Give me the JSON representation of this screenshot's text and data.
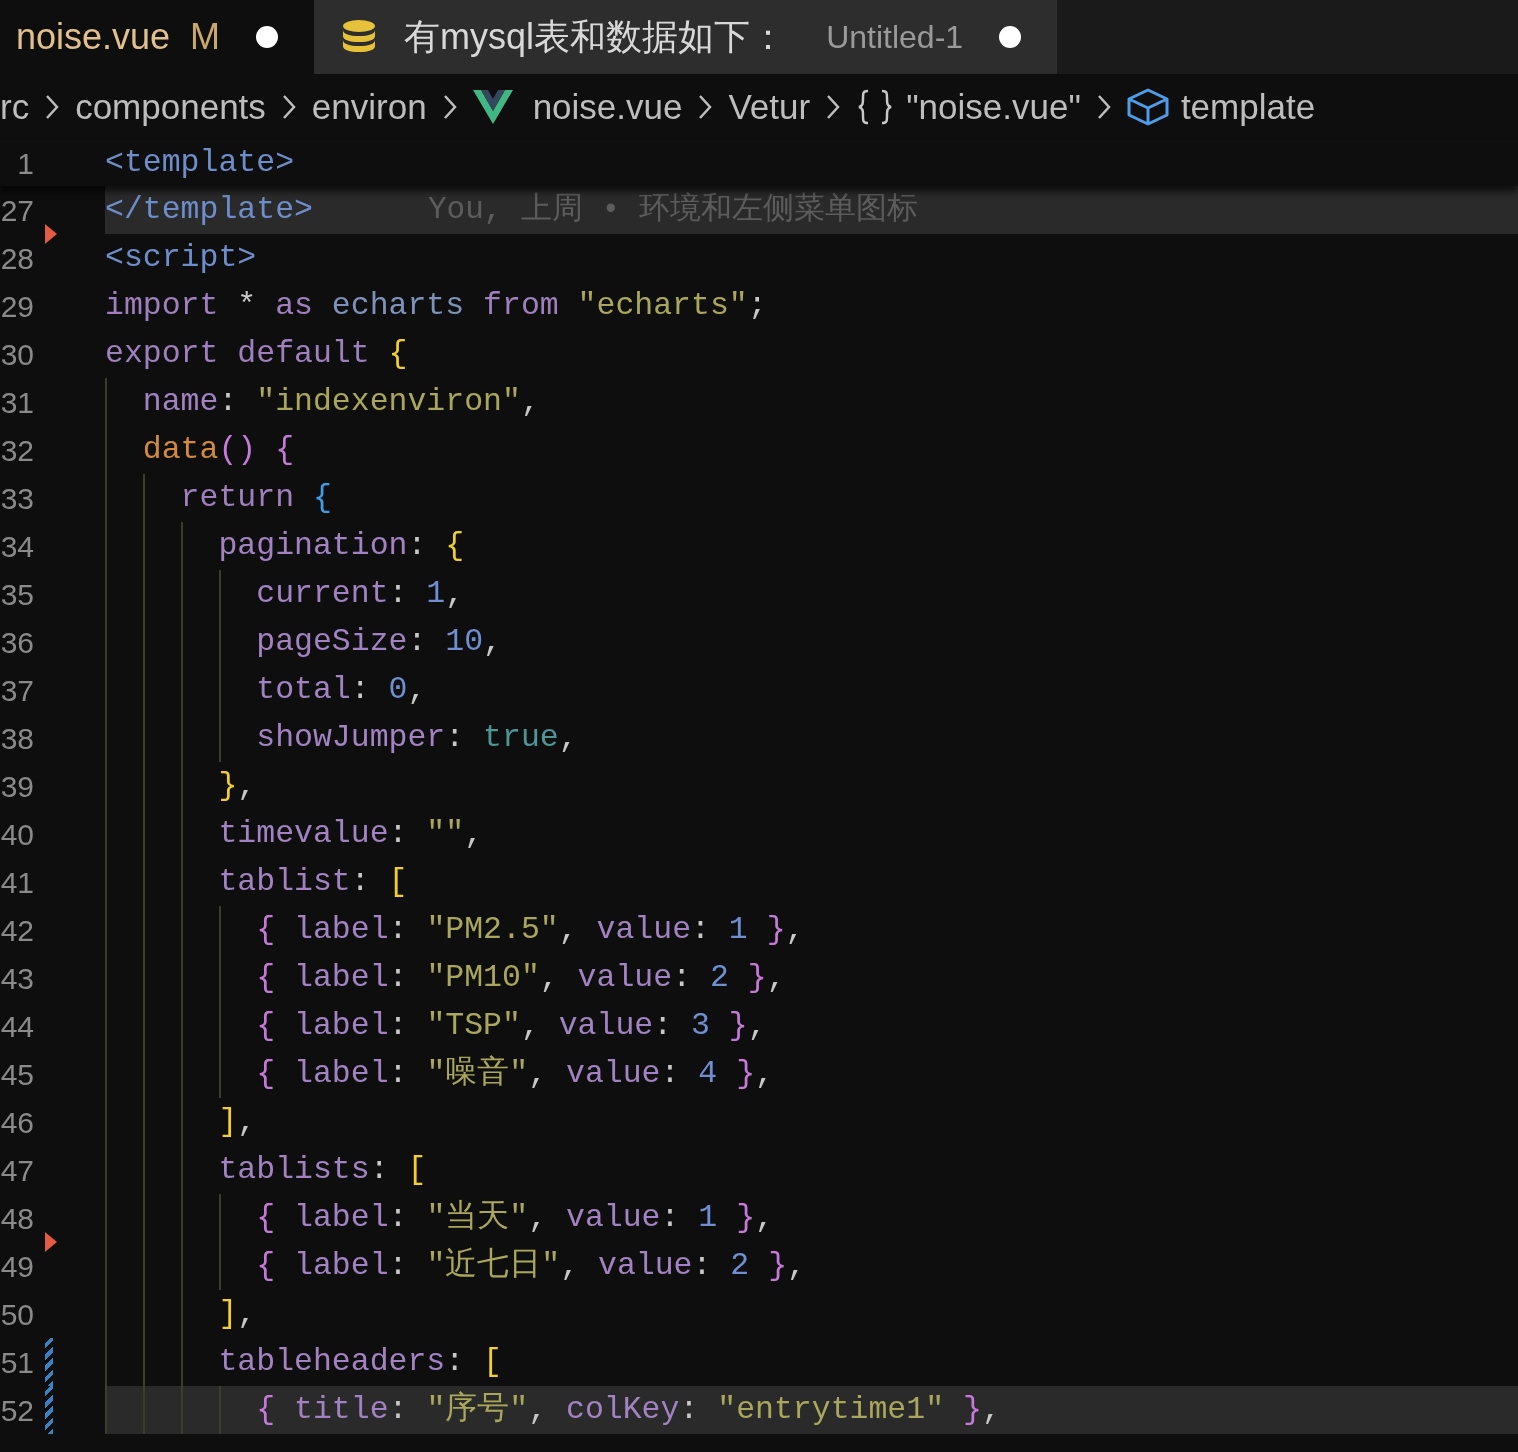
{
  "tabs": [
    {
      "kind": "file",
      "label": "noise.vue",
      "badge": "M",
      "dirty": true,
      "selected": true
    },
    {
      "kind": "query",
      "label": "有mysql表和数据如下：",
      "description": "Untitled-1",
      "dirty": true,
      "selected": false
    }
  ],
  "breadcrumb": [
    {
      "kind": "folder",
      "label": "rc"
    },
    {
      "kind": "folder",
      "label": "components"
    },
    {
      "kind": "folder",
      "label": "environ"
    },
    {
      "kind": "file",
      "label": "noise.vue"
    },
    {
      "kind": "language",
      "label": "Vetur"
    },
    {
      "kind": "module",
      "label": "\"noise.vue\""
    },
    {
      "kind": "element",
      "label": "template"
    }
  ],
  "sticky_line": {
    "number": "1",
    "tokens": [
      {
        "kind": "tag",
        "text": "<template>"
      }
    ]
  },
  "lines": [
    {
      "number": "27",
      "highlighted": true,
      "deleted_above": false,
      "modified": false,
      "blame": "You, 上周 • 环境和左侧菜单图标",
      "tokens": [
        {
          "kind": "tag",
          "text": "</template>"
        }
      ]
    },
    {
      "number": "28",
      "highlighted": false,
      "deleted_above": true,
      "modified": false,
      "tokens": [
        {
          "kind": "tag",
          "text": "<script>"
        }
      ]
    },
    {
      "number": "29",
      "highlighted": false,
      "deleted_above": false,
      "modified": false,
      "tokens": [
        {
          "kind": "keyword",
          "text": "import"
        },
        {
          "kind": "plain",
          "text": " * "
        },
        {
          "kind": "keyword",
          "text": "as"
        },
        {
          "kind": "ident",
          "text": " echarts"
        },
        {
          "kind": "keyword",
          "text": " from"
        },
        {
          "kind": "string",
          "text": " \"echarts\""
        },
        {
          "kind": "plain",
          "text": ";"
        }
      ]
    },
    {
      "number": "30",
      "highlighted": false,
      "deleted_above": false,
      "modified": false,
      "tokens": [
        {
          "kind": "keyword",
          "text": "export default"
        },
        {
          "kind": "brace1",
          "text": " {"
        }
      ]
    },
    {
      "number": "31",
      "highlighted": false,
      "deleted_above": false,
      "modified": false,
      "tokens": [
        {
          "kind": "prop",
          "text": "  name"
        },
        {
          "kind": "plain",
          "text": ": "
        },
        {
          "kind": "string",
          "text": "\"indexenviron\""
        },
        {
          "kind": "plain",
          "text": ","
        }
      ]
    },
    {
      "number": "32",
      "highlighted": false,
      "deleted_above": false,
      "modified": false,
      "tokens": [
        {
          "kind": "func",
          "text": "  data"
        },
        {
          "kind": "brace2",
          "text": "()"
        },
        {
          "kind": "brace2",
          "text": " {"
        }
      ]
    },
    {
      "number": "33",
      "highlighted": false,
      "deleted_above": false,
      "modified": false,
      "tokens": [
        {
          "kind": "keyword",
          "text": "    return"
        },
        {
          "kind": "brace3",
          "text": " {"
        }
      ]
    },
    {
      "number": "34",
      "highlighted": false,
      "deleted_above": false,
      "modified": false,
      "tokens": [
        {
          "kind": "prop",
          "text": "      pagination"
        },
        {
          "kind": "plain",
          "text": ": "
        },
        {
          "kind": "brace1",
          "text": "{"
        }
      ]
    },
    {
      "number": "35",
      "highlighted": false,
      "deleted_above": false,
      "modified": false,
      "tokens": [
        {
          "kind": "prop",
          "text": "        current"
        },
        {
          "kind": "plain",
          "text": ": "
        },
        {
          "kind": "number",
          "text": "1"
        },
        {
          "kind": "plain",
          "text": ","
        }
      ]
    },
    {
      "number": "36",
      "highlighted": false,
      "deleted_above": false,
      "modified": false,
      "tokens": [
        {
          "kind": "prop",
          "text": "        pageSize"
        },
        {
          "kind": "plain",
          "text": ": "
        },
        {
          "kind": "number",
          "text": "10"
        },
        {
          "kind": "plain",
          "text": ","
        }
      ]
    },
    {
      "number": "37",
      "highlighted": false,
      "deleted_above": false,
      "modified": false,
      "tokens": [
        {
          "kind": "prop",
          "text": "        total"
        },
        {
          "kind": "plain",
          "text": ": "
        },
        {
          "kind": "number",
          "text": "0"
        },
        {
          "kind": "plain",
          "text": ","
        }
      ]
    },
    {
      "number": "38",
      "highlighted": false,
      "deleted_above": false,
      "modified": false,
      "tokens": [
        {
          "kind": "prop",
          "text": "        showJumper"
        },
        {
          "kind": "plain",
          "text": ": "
        },
        {
          "kind": "bool",
          "text": "true"
        },
        {
          "kind": "plain",
          "text": ","
        }
      ]
    },
    {
      "number": "39",
      "highlighted": false,
      "deleted_above": false,
      "modified": false,
      "tokens": [
        {
          "kind": "brace1",
          "text": "      }"
        },
        {
          "kind": "plain",
          "text": ","
        }
      ]
    },
    {
      "number": "40",
      "highlighted": false,
      "deleted_above": false,
      "modified": false,
      "tokens": [
        {
          "kind": "prop",
          "text": "      timevalue"
        },
        {
          "kind": "plain",
          "text": ": "
        },
        {
          "kind": "string",
          "text": "\"\""
        },
        {
          "kind": "plain",
          "text": ","
        }
      ]
    },
    {
      "number": "41",
      "highlighted": false,
      "deleted_above": false,
      "modified": false,
      "tokens": [
        {
          "kind": "prop",
          "text": "      tablist"
        },
        {
          "kind": "plain",
          "text": ": "
        },
        {
          "kind": "brace1",
          "text": "["
        }
      ]
    },
    {
      "number": "42",
      "highlighted": false,
      "deleted_above": false,
      "modified": false,
      "tokens": [
        {
          "kind": "brace2",
          "text": "        {"
        },
        {
          "kind": "prop",
          "text": " label"
        },
        {
          "kind": "plain",
          "text": ": "
        },
        {
          "kind": "string",
          "text": "\"PM2.5\""
        },
        {
          "kind": "plain",
          "text": ", "
        },
        {
          "kind": "prop",
          "text": "value"
        },
        {
          "kind": "plain",
          "text": ": "
        },
        {
          "kind": "number",
          "text": "1"
        },
        {
          "kind": "brace2",
          "text": " }"
        },
        {
          "kind": "plain",
          "text": ","
        }
      ]
    },
    {
      "number": "43",
      "highlighted": false,
      "deleted_above": false,
      "modified": false,
      "tokens": [
        {
          "kind": "brace2",
          "text": "        {"
        },
        {
          "kind": "prop",
          "text": " label"
        },
        {
          "kind": "plain",
          "text": ": "
        },
        {
          "kind": "string",
          "text": "\"PM10\""
        },
        {
          "kind": "plain",
          "text": ", "
        },
        {
          "kind": "prop",
          "text": "value"
        },
        {
          "kind": "plain",
          "text": ": "
        },
        {
          "kind": "number",
          "text": "2"
        },
        {
          "kind": "brace2",
          "text": " }"
        },
        {
          "kind": "plain",
          "text": ","
        }
      ]
    },
    {
      "number": "44",
      "highlighted": false,
      "deleted_above": false,
      "modified": false,
      "tokens": [
        {
          "kind": "brace2",
          "text": "        {"
        },
        {
          "kind": "prop",
          "text": " label"
        },
        {
          "kind": "plain",
          "text": ": "
        },
        {
          "kind": "string",
          "text": "\"TSP\""
        },
        {
          "kind": "plain",
          "text": ", "
        },
        {
          "kind": "prop",
          "text": "value"
        },
        {
          "kind": "plain",
          "text": ": "
        },
        {
          "kind": "number",
          "text": "3"
        },
        {
          "kind": "brace2",
          "text": " }"
        },
        {
          "kind": "plain",
          "text": ","
        }
      ]
    },
    {
      "number": "45",
      "highlighted": false,
      "deleted_above": false,
      "modified": false,
      "tokens": [
        {
          "kind": "brace2",
          "text": "        {"
        },
        {
          "kind": "prop",
          "text": " label"
        },
        {
          "kind": "plain",
          "text": ": "
        },
        {
          "kind": "string",
          "text": "\"噪音\""
        },
        {
          "kind": "plain",
          "text": ", "
        },
        {
          "kind": "prop",
          "text": "value"
        },
        {
          "kind": "plain",
          "text": ": "
        },
        {
          "kind": "number",
          "text": "4"
        },
        {
          "kind": "brace2",
          "text": " }"
        },
        {
          "kind": "plain",
          "text": ","
        }
      ]
    },
    {
      "number": "46",
      "highlighted": false,
      "deleted_above": false,
      "modified": false,
      "tokens": [
        {
          "kind": "brace1",
          "text": "      ]"
        },
        {
          "kind": "plain",
          "text": ","
        }
      ]
    },
    {
      "number": "47",
      "highlighted": false,
      "deleted_above": false,
      "modified": false,
      "tokens": [
        {
          "kind": "prop",
          "text": "      tablists"
        },
        {
          "kind": "plain",
          "text": ": "
        },
        {
          "kind": "brace1",
          "text": "["
        }
      ]
    },
    {
      "number": "48",
      "highlighted": false,
      "deleted_above": false,
      "modified": false,
      "tokens": [
        {
          "kind": "brace2",
          "text": "        {"
        },
        {
          "kind": "prop",
          "text": " label"
        },
        {
          "kind": "plain",
          "text": ": "
        },
        {
          "kind": "string",
          "text": "\"当天\""
        },
        {
          "kind": "plain",
          "text": ", "
        },
        {
          "kind": "prop",
          "text": "value"
        },
        {
          "kind": "plain",
          "text": ": "
        },
        {
          "kind": "number",
          "text": "1"
        },
        {
          "kind": "brace2",
          "text": " }"
        },
        {
          "kind": "plain",
          "text": ","
        }
      ]
    },
    {
      "number": "49",
      "highlighted": false,
      "deleted_above": true,
      "modified": false,
      "tokens": [
        {
          "kind": "brace2",
          "text": "        {"
        },
        {
          "kind": "prop",
          "text": " label"
        },
        {
          "kind": "plain",
          "text": ": "
        },
        {
          "kind": "string",
          "text": "\"近七日\""
        },
        {
          "kind": "plain",
          "text": ", "
        },
        {
          "kind": "prop",
          "text": "value"
        },
        {
          "kind": "plain",
          "text": ": "
        },
        {
          "kind": "number",
          "text": "2"
        },
        {
          "kind": "brace2",
          "text": " }"
        },
        {
          "kind": "plain",
          "text": ","
        }
      ]
    },
    {
      "number": "50",
      "highlighted": false,
      "deleted_above": false,
      "modified": false,
      "tokens": [
        {
          "kind": "brace1",
          "text": "      ]"
        },
        {
          "kind": "plain",
          "text": ","
        }
      ]
    },
    {
      "number": "51",
      "highlighted": false,
      "deleted_above": false,
      "modified": true,
      "tokens": [
        {
          "kind": "prop",
          "text": "      tableheaders"
        },
        {
          "kind": "plain",
          "text": ": "
        },
        {
          "kind": "brace1",
          "text": "["
        }
      ]
    },
    {
      "number": "52",
      "highlighted": true,
      "deleted_above": false,
      "modified": true,
      "tokens": [
        {
          "kind": "brace2",
          "text": "        {"
        },
        {
          "kind": "prop",
          "text": " title"
        },
        {
          "kind": "plain",
          "text": ": "
        },
        {
          "kind": "string",
          "text": "\"序号\""
        },
        {
          "kind": "plain",
          "text": ", "
        },
        {
          "kind": "prop",
          "text": "colKey"
        },
        {
          "kind": "plain",
          "text": ": "
        },
        {
          "kind": "string",
          "text": "\"entrytime1\""
        },
        {
          "kind": "brace2",
          "text": " }"
        },
        {
          "kind": "plain",
          "text": ","
        }
      ]
    }
  ]
}
